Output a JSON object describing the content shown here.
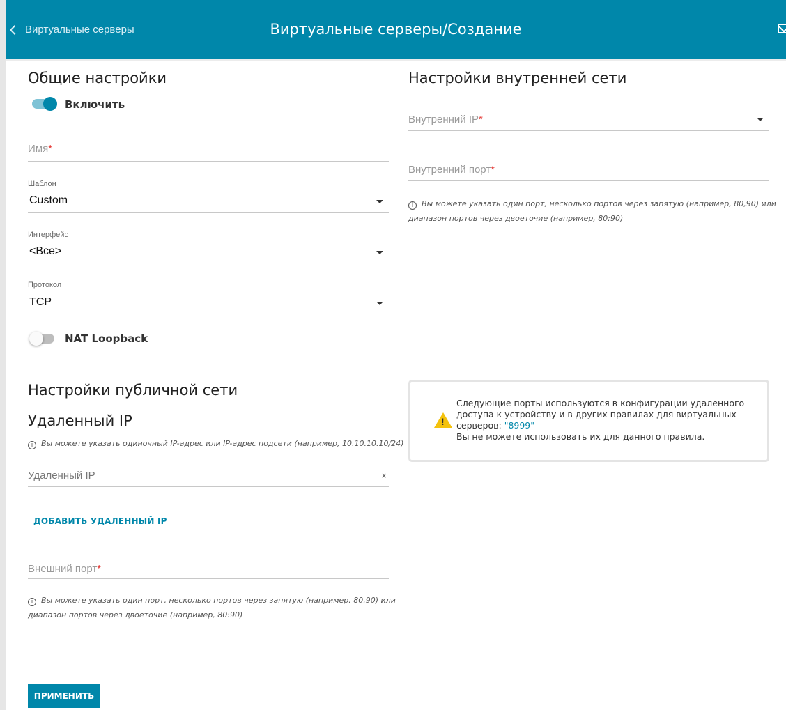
{
  "header": {
    "back_label": "Виртуальные серверы",
    "title": "Виртуальные серверы/Создание",
    "mail_icon": "mail-icon"
  },
  "general": {
    "heading": "Общие настройки",
    "enable_label": "Включить",
    "enable_on": true,
    "name_placeholder": "Имя",
    "template_label": "Шаблон",
    "template_value": "Custom",
    "interface_label": "Интерфейс",
    "interface_value": "<Все>",
    "protocol_label": "Протокол",
    "protocol_value": "TCP",
    "nat_loopback_label": "NAT Loopback",
    "nat_loopback_on": false
  },
  "public": {
    "heading": "Настройки публичной сети",
    "remote_ip_heading": "Удаленный IP",
    "remote_ip_hint": "Вы можете указать одиночный IP-адрес или IP-адрес подсети (например, 10.10.10.10/24)",
    "remote_ip_placeholder": "Удаленный IP",
    "remote_ip_clear": "×",
    "add_remote_ip": "ДОБАВИТЬ УДАЛЕННЫЙ IP",
    "external_port_placeholder": "Внешний порт",
    "external_port_hint_1": "Вы можете указать один порт, несколько портов через запятую (например, 80,90) или",
    "external_port_hint_2": "диапазон портов через двоеточие (например, 80:90)"
  },
  "internal": {
    "heading": "Настройки внутренней сети",
    "internal_ip_placeholder": "Внутренний IP",
    "internal_port_placeholder": "Внутренний порт",
    "internal_port_hint_1": "Вы можете указать один порт, несколько портов через запятую (например, 80,90) или",
    "internal_port_hint_2": "диапазон портов через двоеточие (например, 80:90)"
  },
  "warning": {
    "text_1": "Следующие порты используются в конфигурации удаленного доступа к устройству и в других правилах для виртуальных серверов: ",
    "ports": "\"8999\"",
    "text_2": "Вы не можете использовать их для данного правила."
  },
  "info_glyph": "i",
  "required_mark": "*",
  "apply_label": "ПРИМЕНИТЬ",
  "colors": {
    "accent": "#0087aa",
    "required": "#e53935",
    "warning": "#f4c20d"
  }
}
